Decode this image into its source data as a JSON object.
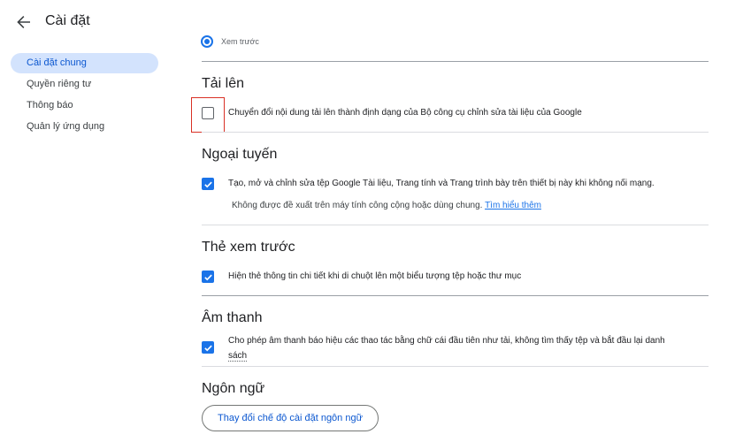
{
  "header": {
    "title": "Cài đặt",
    "back_icon": "arrow-back-icon"
  },
  "sidebar": {
    "items": [
      {
        "label": "Cài đặt chung",
        "active": true
      },
      {
        "label": "Quyền riêng tư",
        "active": false
      },
      {
        "label": "Thông báo",
        "active": false
      },
      {
        "label": "Quản lý ứng dụng",
        "active": false
      }
    ]
  },
  "main": {
    "preview_radio_label": "Xem trước",
    "upload": {
      "title": "Tải lên",
      "option": "Chuyển đổi nội dung tải lên thành định dạng của Bộ công cụ chỉnh sửa tài liệu của Google",
      "checked": false
    },
    "offline": {
      "title": "Ngoại tuyến",
      "option": "Tạo, mở và chỉnh sửa tệp Google Tài liệu, Trang tính và Trang trình bày trên thiết bị này khi không nối mạng.",
      "checked": true,
      "note": "Không được đề xuất trên máy tính công cộng hoặc dùng chung.",
      "link": "Tìm hiểu thêm"
    },
    "preview_cards": {
      "title": "Thẻ xem trước",
      "option": "Hiện thẻ thông tin chi tiết khi di chuột lên một biểu tượng tệp hoặc thư mục",
      "checked": true
    },
    "sound": {
      "title": "Âm thanh",
      "option_line1": "Cho phép âm thanh báo hiệu các thao tác bằng chữ cái đầu tiên như tải, không tìm thấy tệp và bắt đầu lại danh",
      "option_line2": "sách",
      "checked": true
    },
    "language": {
      "title": "Ngôn ngữ",
      "button": "Thay đổi chế độ cài đặt ngôn ngữ"
    }
  },
  "colors": {
    "accent": "#1a73e8",
    "active_nav_bg": "#d3e3fd",
    "highlight_border": "#d93025"
  }
}
